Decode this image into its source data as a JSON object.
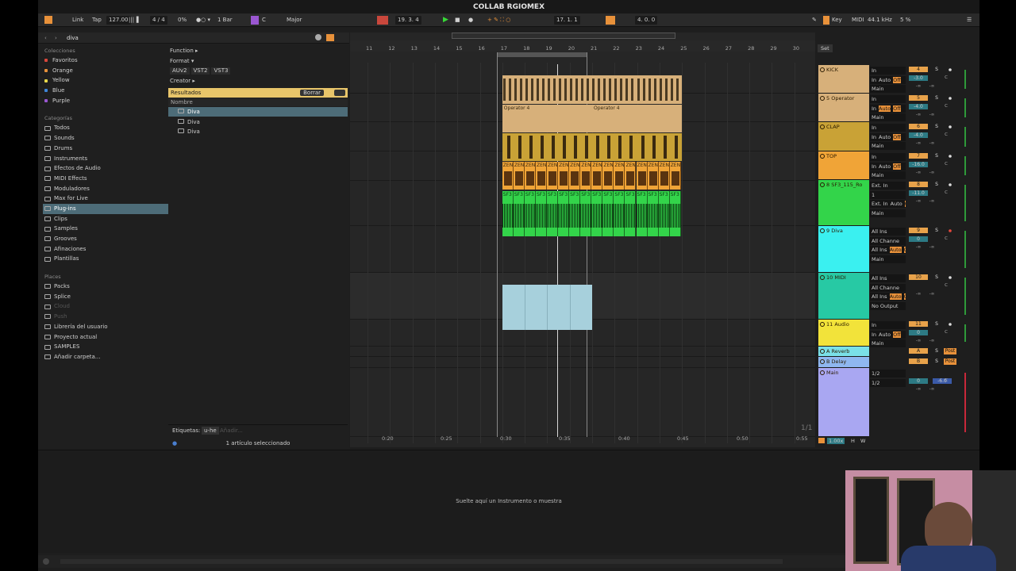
{
  "window": {
    "title": "COLLAB RGIOMEX"
  },
  "topbar": {
    "link": "Link",
    "tap": "Tap",
    "tempo": "127.00",
    "signature": "4 / 4",
    "swing": "0%",
    "quantize": "1 Bar",
    "key": "C",
    "scale": "Major",
    "position": "19.  3.  4",
    "loop_start": "17.  1.  1",
    "loop_length": "4.  0.  0",
    "key_label": "Key",
    "midi_label": "MIDI",
    "sample_rate": "44.1 kHz",
    "cpu": "5 %"
  },
  "browser": {
    "search_value": "diva",
    "collections_header": "Colecciones",
    "collections": [
      {
        "label": "Favoritos",
        "color": "#d8473c"
      },
      {
        "label": "Orange",
        "color": "#e8913a"
      },
      {
        "label": "Yellow",
        "color": "#e8d84a"
      },
      {
        "label": "Blue",
        "color": "#3f86d8"
      },
      {
        "label": "Purple",
        "color": "#9a57d1"
      }
    ],
    "categories_header": "Categorías",
    "categories": [
      "Todos",
      "Sounds",
      "Drums",
      "Instruments",
      "Efectos de Audio",
      "MIDI Effects",
      "Moduladores",
      "Max for Live",
      "Plug-ins",
      "Clips",
      "Samples",
      "Grooves",
      "Afinaciones",
      "Plantillas"
    ],
    "selected_category": "Plug-ins",
    "places_header": "Places",
    "places": [
      "Packs",
      "Splice",
      "Cloud",
      "Push",
      "Librería del usuario",
      "Proyecto actual",
      "SAMPLES",
      "Añadir carpeta..."
    ],
    "dim_places": [
      "Cloud",
      "Push"
    ],
    "filters": {
      "function": "Function ▸",
      "format": "Format ▾",
      "formats": [
        "AUv2",
        "VST2",
        "VST3"
      ],
      "creator": "Creator ▸"
    },
    "results_label": "Resultados",
    "clear_label": "Borrar",
    "name_header": "Nombre",
    "results": [
      "Diva",
      "Diva",
      "Diva"
    ],
    "tags_label": "Etiquetas:",
    "tag": "u-he",
    "add_tag": "Añadir...",
    "status": "1 artículo seleccionado"
  },
  "arrangement": {
    "bar_numbers": [
      "11",
      "12",
      "13",
      "14",
      "15",
      "16",
      "17",
      "18",
      "19",
      "20",
      "21",
      "22",
      "23",
      "24",
      "25",
      "26",
      "27",
      "28",
      "29",
      "30"
    ],
    "time_labels": [
      "0:20",
      "0:25",
      "0:30",
      "0:35",
      "0:40",
      "0:45",
      "0:50",
      "0:55"
    ],
    "clip_labels": {
      "operator": "Operator 4",
      "zen": "ZEN",
      "sf": "SF3"
    },
    "page_indicator": "1/1"
  },
  "mixer": {
    "set_label": "Set",
    "tracks": [
      {
        "name": "KICK",
        "color": "#d7b07a",
        "num": "4",
        "input": "In",
        "auto": "Auto",
        "off": "Off",
        "out": "Main",
        "vol": "-3.0"
      },
      {
        "name": "5 Operator",
        "color": "#d7b07a",
        "num": "5",
        "input": "In",
        "auto": "Auto",
        "off": "Off",
        "out": "Main",
        "vol": "-4.0"
      },
      {
        "name": "CLAP",
        "color": "#c9a236",
        "num": "6",
        "input": "In",
        "auto": "Auto",
        "off": "Off",
        "out": "Main",
        "vol": "-4.0"
      },
      {
        "name": "TOP",
        "color": "#f0a437",
        "num": "7",
        "input": "In",
        "auto": "Auto",
        "off": "Off",
        "out": "Main",
        "vol": "-16.0"
      },
      {
        "name": "8 SF3_115_Ro",
        "color": "#33d44a",
        "num": "8",
        "input": "Ext. In",
        "auto": "Auto",
        "off": "Off",
        "out": "Main",
        "vol": "-11.0",
        "ch": "1"
      },
      {
        "name": "9 Diva",
        "color": "#3af0f0",
        "num": "9",
        "input": "All Ins",
        "auto": "Auto",
        "off": "Off",
        "out": "Main",
        "vol": "0",
        "ch": "All Channe"
      },
      {
        "name": "10 MIDI",
        "color": "#27c9a4",
        "num": "10",
        "input": "All Ins",
        "auto": "Auto",
        "off": "Off",
        "out": "No Output",
        "vol": "",
        "ch": "All Channe"
      },
      {
        "name": "11 Audio",
        "color": "#f2e33a",
        "num": "11",
        "input": "In",
        "auto": "Auto",
        "off": "Off",
        "out": "Main",
        "vol": "0"
      },
      {
        "name": "A Reverb",
        "color": "#7ae0e8",
        "num": "A",
        "post": "Post"
      },
      {
        "name": "B Delay",
        "color": "#8fb7f0",
        "num": "B",
        "post": "Post"
      },
      {
        "name": "Main",
        "color": "#a9a7f2",
        "out": "1/2",
        "out2": "1/2",
        "vol": "0",
        "vol2": "-6.0"
      }
    ],
    "inf": "-∞",
    "c": "C",
    "s": "S",
    "zoom": "1.00x",
    "h": "H",
    "w": "W"
  },
  "dropzone": {
    "text": "Suelte aquí un Instrumento o muestra"
  }
}
